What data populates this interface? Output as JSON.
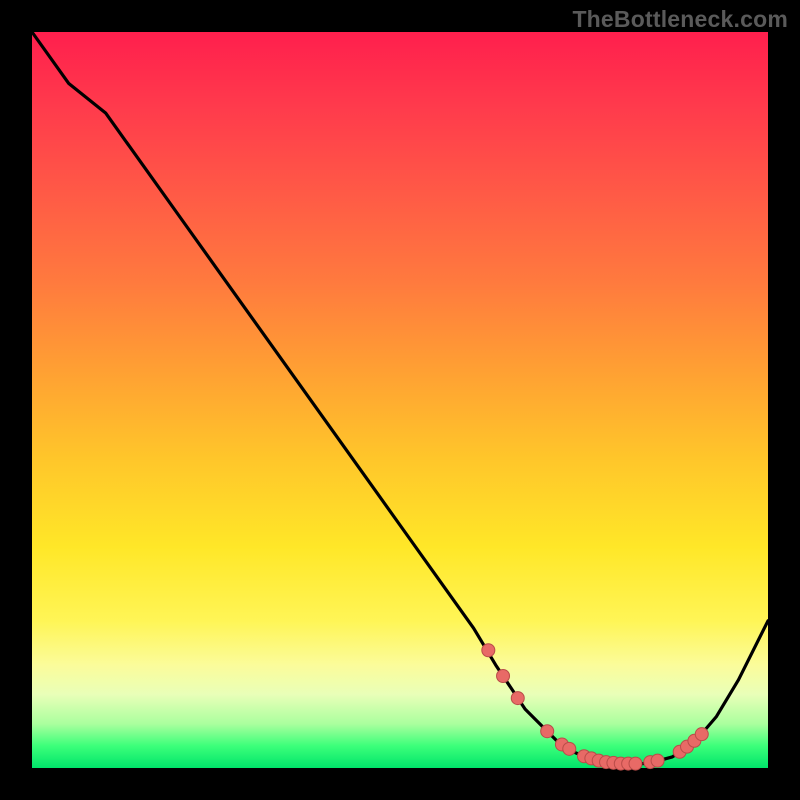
{
  "watermark": "TheBottleneck.com",
  "colors": {
    "curve_stroke": "#000000",
    "dot_fill": "#e86a66",
    "dot_stroke": "#b94c49",
    "background_black": "#000000"
  },
  "chart_data": {
    "type": "line",
    "title": "",
    "xlabel": "",
    "ylabel": "",
    "xlim": [
      0,
      100
    ],
    "ylim": [
      0,
      100
    ],
    "grid": false,
    "legend": false,
    "series": [
      {
        "name": "bottleneck-curve",
        "x": [
          0,
          5,
          10,
          15,
          20,
          25,
          30,
          35,
          40,
          45,
          50,
          55,
          60,
          63,
          65,
          67,
          70,
          72,
          74,
          76,
          78,
          80,
          82,
          84,
          87,
          90,
          93,
          96,
          100
        ],
        "y": [
          100,
          93,
          89,
          82,
          75,
          68,
          61,
          54,
          47,
          40,
          33,
          26,
          19,
          14,
          11,
          8,
          5,
          3,
          2,
          1.2,
          0.7,
          0.5,
          0.5,
          0.7,
          1.5,
          3.5,
          7,
          12,
          20
        ]
      }
    ],
    "marker_points": {
      "name": "highlighted-dots",
      "x": [
        62,
        64,
        66,
        70,
        72,
        73,
        75,
        76,
        77,
        78,
        79,
        80,
        81,
        82,
        84,
        85,
        88,
        89,
        90,
        91
      ],
      "y": [
        16,
        12.5,
        9.5,
        5,
        3.2,
        2.6,
        1.6,
        1.3,
        1.0,
        0.8,
        0.7,
        0.6,
        0.6,
        0.6,
        0.8,
        1.0,
        2.2,
        2.9,
        3.7,
        4.6
      ]
    }
  }
}
